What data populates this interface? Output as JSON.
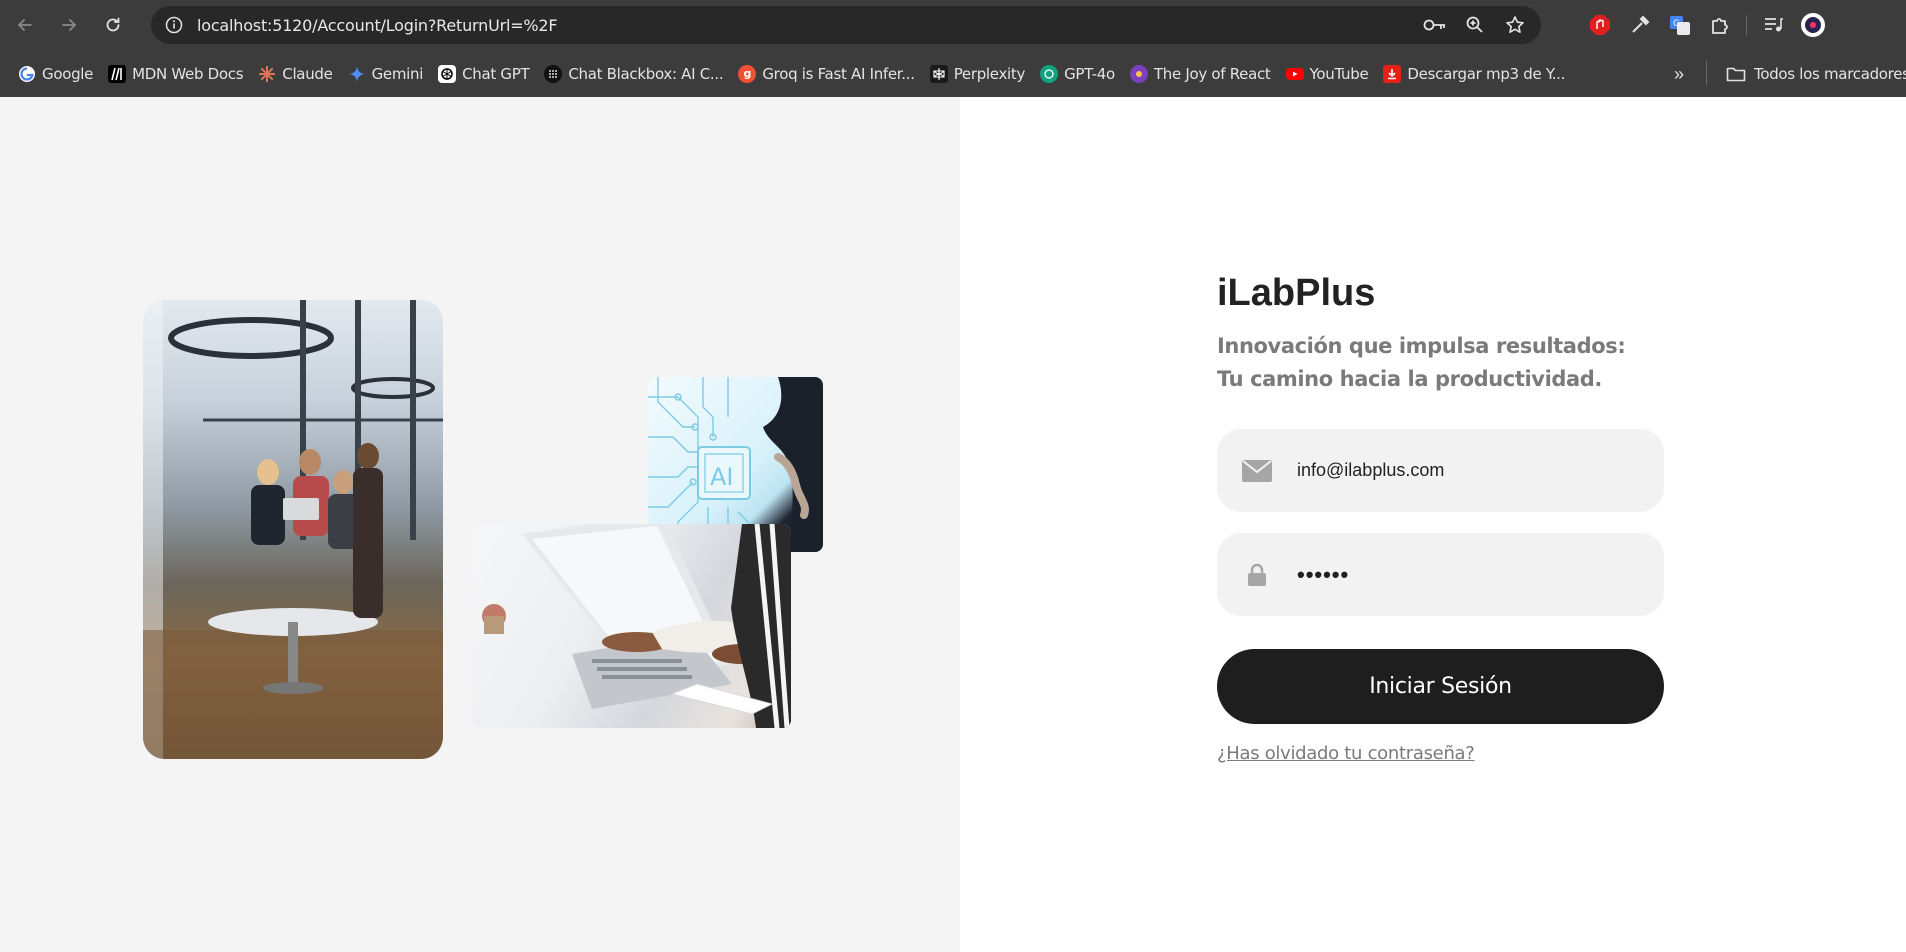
{
  "browser": {
    "url": "localhost:5120/Account/Login?ReturnUrl=%2F",
    "bookmarks": [
      {
        "label": "Google",
        "icon": "google-icon",
        "color": "#4285f4"
      },
      {
        "label": "MDN Web Docs",
        "icon": "mdn-icon",
        "color": "#000000"
      },
      {
        "label": "Claude",
        "icon": "claude-icon",
        "color": "#d97757"
      },
      {
        "label": "Gemini",
        "icon": "gemini-icon",
        "color": "#4f8df5"
      },
      {
        "label": "Chat  GPT",
        "icon": "chatgpt-icon",
        "color": "#ffffff"
      },
      {
        "label": "Chat Blackbox: AI C...",
        "icon": "blackbox-icon",
        "color": "#111111"
      },
      {
        "label": "Groq is Fast AI Infer...",
        "icon": "groq-icon",
        "color": "#f55036"
      },
      {
        "label": "Perplexity",
        "icon": "perplexity-icon",
        "color": "#1a1a1a"
      },
      {
        "label": "GPT-4o",
        "icon": "gpt4o-icon",
        "color": "#10a37f"
      },
      {
        "label": "The Joy of React",
        "icon": "joy-of-react-icon",
        "color": "#7b3fbf"
      },
      {
        "label": "YouTube",
        "icon": "youtube-icon",
        "color": "#ff0000"
      },
      {
        "label": "Descargar mp3 de Y...",
        "icon": "download-icon",
        "color": "#e62117"
      }
    ],
    "all_bookmarks_label": "Todos los marcadores"
  },
  "login": {
    "brand": "iLabPlus",
    "tagline": "Innovación que impulsa resultados: Tu camino hacia la productividad.",
    "email_value": "info@ilabplus.com",
    "password_value": "••••••",
    "submit_label": "Iniciar Sesión",
    "forgot_label": "¿Has olvidado tu contraseña?"
  }
}
